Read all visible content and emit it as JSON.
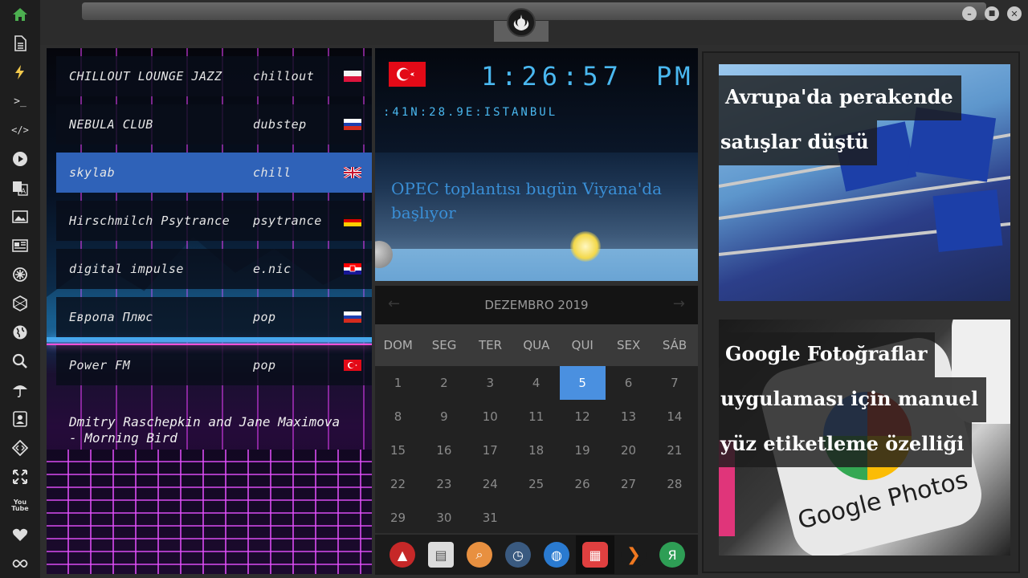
{
  "sidebar": {
    "items": [
      {
        "icon": "home-icon",
        "glyph": "⌂"
      },
      {
        "icon": "document-icon",
        "glyph": "▤"
      },
      {
        "icon": "lightning-icon",
        "glyph": "⚡"
      },
      {
        "icon": "terminal-icon",
        "glyph": ">_"
      },
      {
        "icon": "code-icon",
        "glyph": "</>"
      },
      {
        "icon": "play-icon",
        "glyph": "▶"
      },
      {
        "icon": "translate-icon",
        "glyph": "A"
      },
      {
        "icon": "image-icon",
        "glyph": "▣"
      },
      {
        "icon": "news-icon",
        "glyph": "▦"
      },
      {
        "icon": "settings-icon",
        "glyph": "✲"
      },
      {
        "icon": "hexagon-icon",
        "glyph": "⬡"
      },
      {
        "icon": "globe-icon",
        "glyph": "◍"
      },
      {
        "icon": "search-icon",
        "glyph": "⌕"
      },
      {
        "icon": "umbrella-icon",
        "glyph": "☂"
      },
      {
        "icon": "contact-card-icon",
        "glyph": "☺"
      },
      {
        "icon": "code-diamond-icon",
        "glyph": "◇"
      },
      {
        "icon": "expand-icon",
        "glyph": "✥"
      },
      {
        "icon": "youtube-icon",
        "glyph": "You\nTube"
      },
      {
        "icon": "heart-icon",
        "glyph": "♥"
      },
      {
        "icon": "infinity-icon",
        "glyph": "∞"
      }
    ]
  },
  "radio": {
    "stations": [
      {
        "name": "CHILLOUT LOUNGE JAZZ",
        "genre": "chillout",
        "flag": "poland-flag"
      },
      {
        "name": "NEBULA CLUB",
        "genre": "dubstep",
        "flag": "russia-flag"
      },
      {
        "name": "skylab",
        "genre": "chill",
        "flag": "uk-flag"
      },
      {
        "name": "Hirschmilch Psytrance",
        "genre": "psytrance",
        "flag": "germany-flag"
      },
      {
        "name": "digital impulse",
        "genre": "e.nic",
        "flag": "croatia-flag"
      },
      {
        "name": "Европа Плюс",
        "genre": "pop",
        "flag": "russia-flag"
      },
      {
        "name": "Power FM",
        "genre": "pop",
        "flag": "turkey-flag"
      }
    ],
    "active_index": 2,
    "now_playing": "Dmitry Raschepkin and Jane Maximova - Morning Bird"
  },
  "clock": {
    "time": "1:26:57",
    "ampm": "PM",
    "location": ":41N:28.9E:ISTANBUL",
    "headline": "OPEC toplantısı bugün Viyana'da başlıyor"
  },
  "calendar": {
    "month": "DEZEMBRO 2019",
    "prev": "←",
    "next": "→",
    "weekdays": [
      "DOM",
      "SEG",
      "TER",
      "QUA",
      "QUI",
      "SEX",
      "SÁB"
    ],
    "weeks": [
      [
        "1",
        "2",
        "3",
        "4",
        "5",
        "6",
        "7"
      ],
      [
        "8",
        "9",
        "10",
        "11",
        "12",
        "13",
        "14"
      ],
      [
        "15",
        "16",
        "17",
        "18",
        "19",
        "20",
        "21"
      ],
      [
        "22",
        "23",
        "24",
        "25",
        "26",
        "27",
        "28"
      ],
      [
        "29",
        "30",
        "31"
      ]
    ],
    "today": "5"
  },
  "dock": {
    "apps": [
      {
        "icon": "arrow-app-icon",
        "glyph": "▲",
        "color": "#c62828"
      },
      {
        "icon": "news-app-icon",
        "glyph": "▤",
        "color": "#dcdcdc"
      },
      {
        "icon": "search-app-icon",
        "glyph": "⌕",
        "color": "#e89040"
      },
      {
        "icon": "clock-app-icon",
        "glyph": "◷",
        "color": "#3a5a80"
      },
      {
        "icon": "globe-app-icon",
        "glyph": "◍",
        "color": "#2a7ad0"
      },
      {
        "icon": "calendar-app-icon",
        "glyph": "▦",
        "color": "#e04040"
      },
      {
        "icon": "play-arrow-app-icon",
        "glyph": "❯",
        "color": "#1b1b1b"
      },
      {
        "icon": "yandex-app-icon",
        "glyph": "Я",
        "color": "#2e9e55"
      }
    ],
    "selected_index": 5
  },
  "news": {
    "item1_lines": [
      "Avrupa'da perakende",
      "satışlar düştü"
    ],
    "item2_lines": [
      "Google Fotoğraflar",
      "uygulaması için manuel",
      "yüz etiketleme özelliği"
    ],
    "item2_image_text": "Google Photos"
  },
  "colors": {
    "accent_blue": "#4a90e0",
    "digital_blue": "#4ab8f0",
    "active_station": "#2f62b8"
  }
}
